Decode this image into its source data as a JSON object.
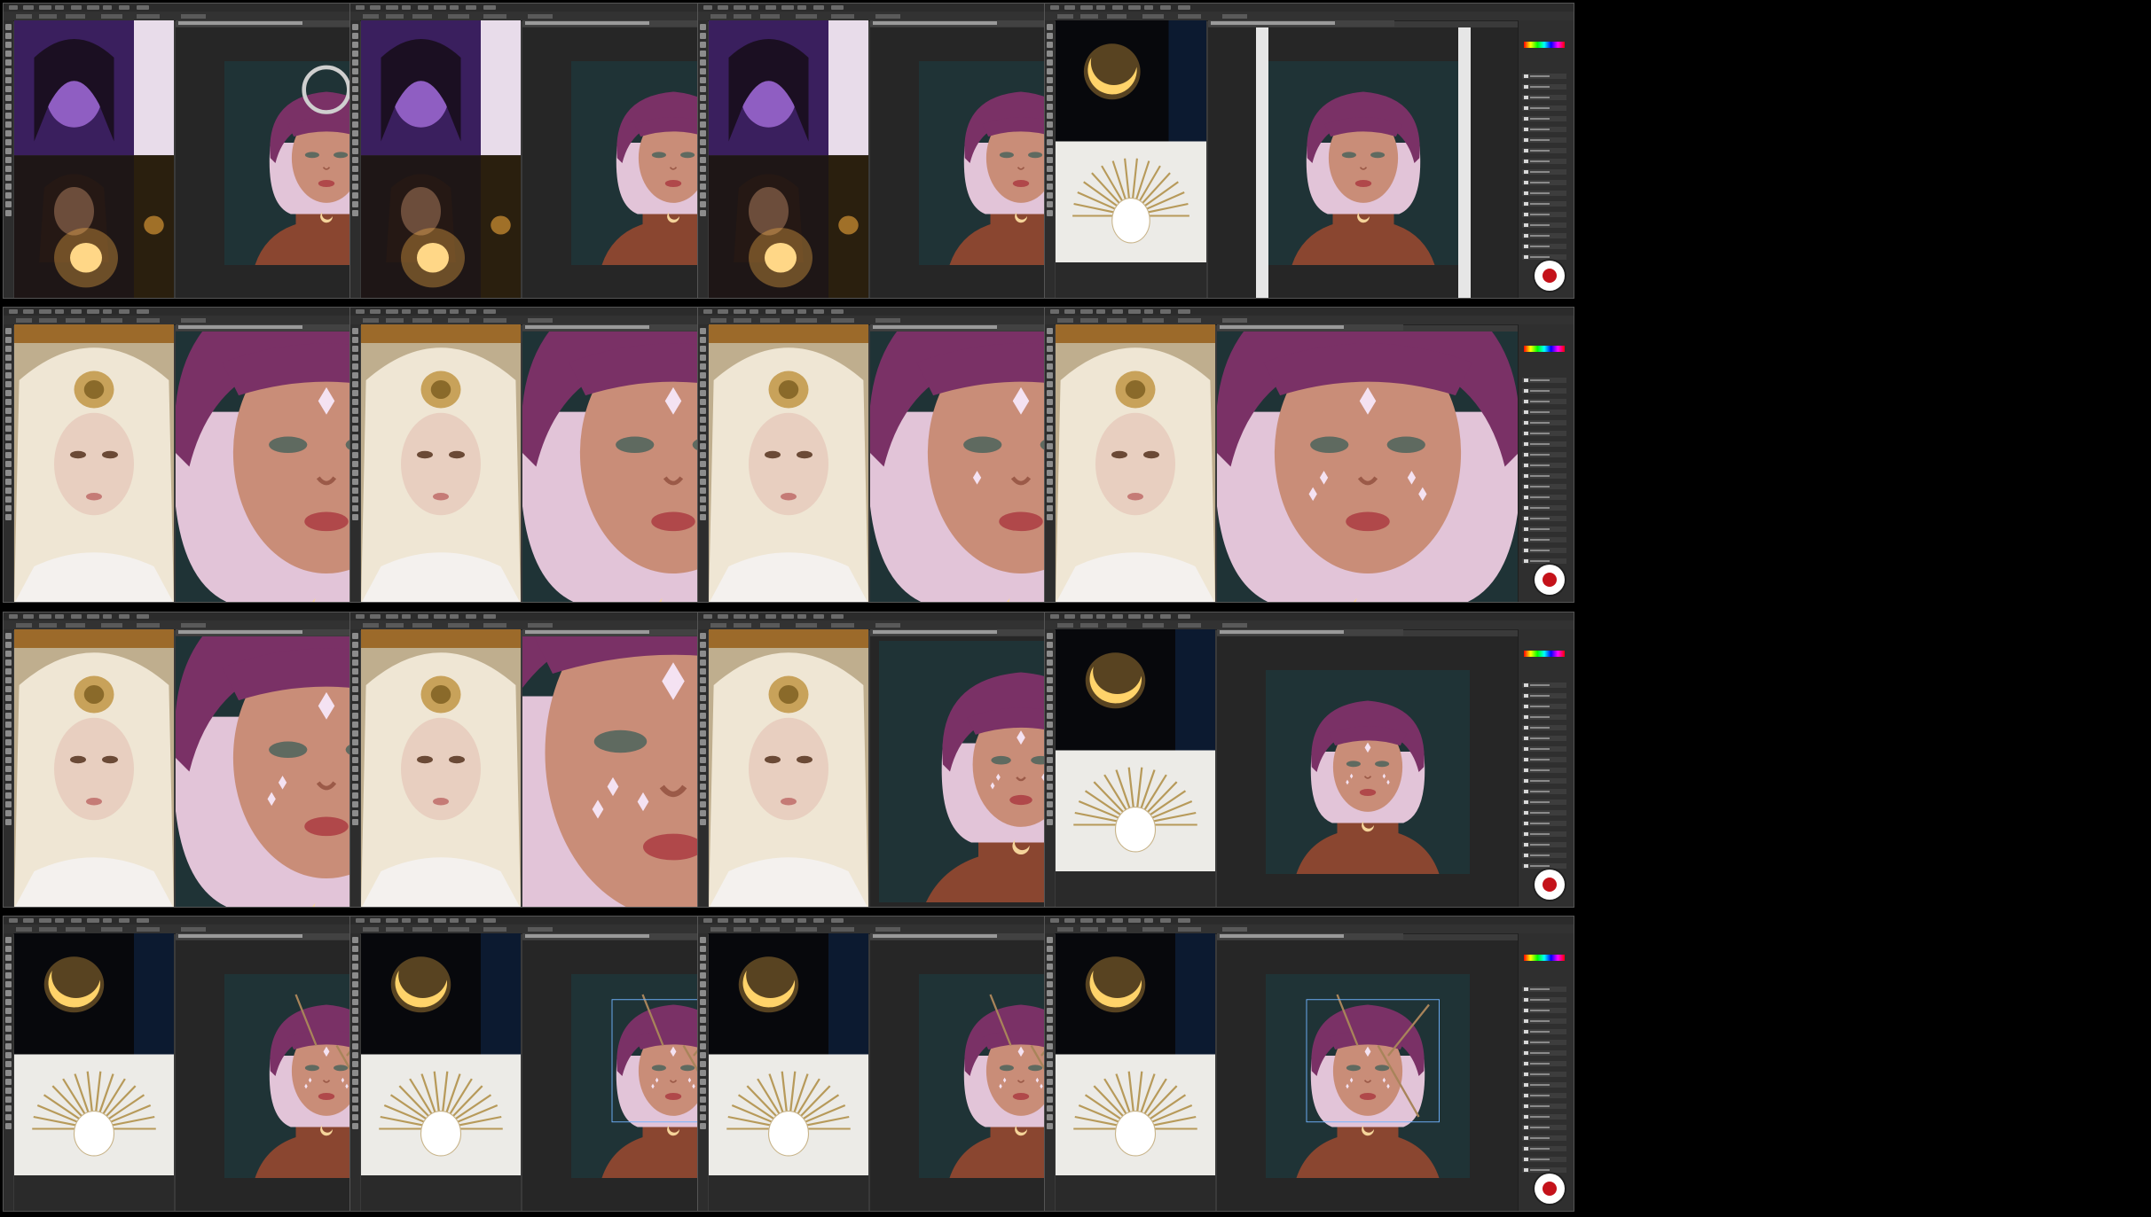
{
  "colors": {
    "ui_dark": "#2b2b2b",
    "ui_mid": "#3a3a3a",
    "canvas_bg": "#1f3336",
    "hair": "#7a3166",
    "hair_light": "#e2c4d8",
    "skin": "#c98d78",
    "neck": "#8a4630",
    "moon": "#f2b14a",
    "record_red": "#c4121a"
  },
  "grid": {
    "rows": 4,
    "cols": 4
  },
  "frames": [
    {
      "step": 1,
      "refs": "portraits",
      "scene": "full",
      "zoom": "far",
      "jewels": 0,
      "crown": false,
      "brush_circle": true
    },
    {
      "step": 2,
      "refs": "portraits",
      "scene": "full",
      "zoom": "far",
      "jewels": 0,
      "crown": false,
      "brush_circle": false
    },
    {
      "step": 3,
      "refs": "portraits",
      "scene": "full",
      "zoom": "far",
      "jewels": 0,
      "crown": false,
      "brush_circle": false
    },
    {
      "step": 4,
      "refs": "moon-crown",
      "scene": "full",
      "zoom": "far",
      "jewels": 0,
      "crown": false,
      "brush_circle": false,
      "white_side_bars": true
    },
    {
      "step": 5,
      "refs": "blonde",
      "scene": "face",
      "zoom": "near",
      "jewels": 1,
      "crown": false,
      "brush_circle": false
    },
    {
      "step": 6,
      "refs": "blonde",
      "scene": "face",
      "zoom": "near",
      "jewels": 1,
      "crown": false,
      "brush_circle": false
    },
    {
      "step": 7,
      "refs": "blonde",
      "scene": "face",
      "zoom": "near",
      "jewels": 3,
      "crown": false,
      "brush_circle": false
    },
    {
      "step": 8,
      "refs": "blonde",
      "scene": "face",
      "zoom": "near",
      "jewels": 5,
      "crown": false,
      "brush_circle": false
    },
    {
      "step": 9,
      "refs": "blonde",
      "scene": "face",
      "zoom": "near",
      "jewels": 5,
      "crown": false,
      "brush_circle": false
    },
    {
      "step": 10,
      "refs": "blonde",
      "scene": "face",
      "zoom": "closest",
      "jewels": 7,
      "crown": false,
      "brush_circle": false
    },
    {
      "step": 11,
      "refs": "blonde",
      "scene": "full",
      "zoom": "mid",
      "jewels": 5,
      "crown": false,
      "brush_circle": false
    },
    {
      "step": 12,
      "refs": "moon-crown",
      "scene": "full",
      "zoom": "far",
      "jewels": 5,
      "crown": false,
      "brush_circle": false
    },
    {
      "step": 13,
      "refs": "moon-crown",
      "scene": "full",
      "zoom": "far",
      "jewels": 5,
      "crown": true,
      "brush_circle": false
    },
    {
      "step": 14,
      "refs": "moon-crown",
      "scene": "full",
      "zoom": "far",
      "jewels": 5,
      "crown": true,
      "brush_circle": false,
      "transform_box": true
    },
    {
      "step": 15,
      "refs": "moon-crown",
      "scene": "full",
      "zoom": "far",
      "jewels": 5,
      "crown": true,
      "brush_circle": false
    },
    {
      "step": 16,
      "refs": "moon-crown",
      "scene": "full",
      "zoom": "far",
      "jewels": 5,
      "crown": true,
      "brush_circle": false,
      "transform_box": true
    }
  ]
}
